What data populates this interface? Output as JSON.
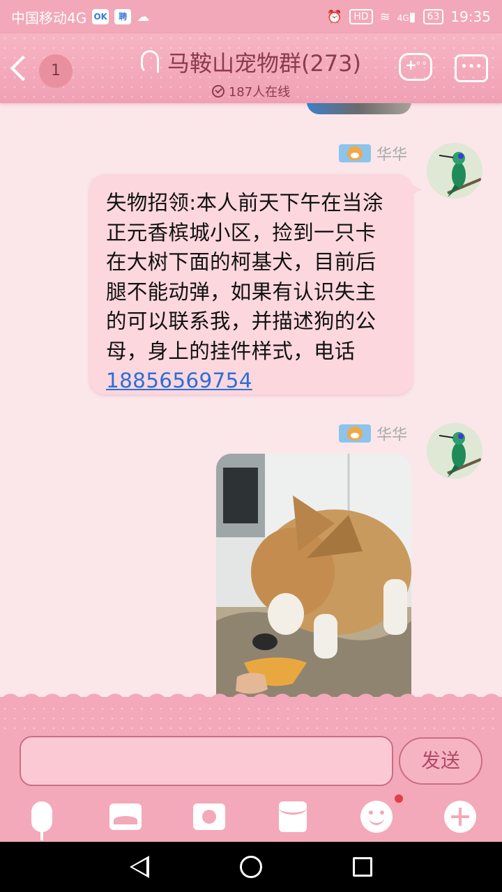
{
  "status_bar": {
    "carrier": "中国移动4G",
    "time": "19:35",
    "battery": "63",
    "hd_label": "HD",
    "signal_label": "4G",
    "icons": [
      "ok-app-icon",
      "hire-app-icon",
      "cloud-icon",
      "alarm-icon",
      "wifi-icon",
      "signal-icon",
      "battery-icon"
    ]
  },
  "header": {
    "unread_count": "1",
    "title": "马鞍山宠物群(273)",
    "online": "187人在线"
  },
  "messages": [
    {
      "sender": "华华",
      "type": "text",
      "text": "失物招领:本人前天下午在当涂正元香槟城小区，捡到一只卡在大树下面的柯基犬，目前后腿不能动弹，如果有认识失主的可以联系我，并描述狗的公母，身上的挂件样式，电话",
      "phone": "18856569754"
    },
    {
      "sender": "华华",
      "type": "image",
      "image_desc": "corgi-photo"
    }
  ],
  "input": {
    "value": "",
    "send_label": "发送"
  },
  "toolbar_icons": [
    "microphone-icon",
    "photo-icon",
    "camera-icon",
    "red-envelope-icon",
    "emoji-icon",
    "plus-icon"
  ],
  "colors": {
    "accent": "#f3a9b9",
    "bubble": "#fcd7de",
    "link": "#2a6fd6"
  }
}
